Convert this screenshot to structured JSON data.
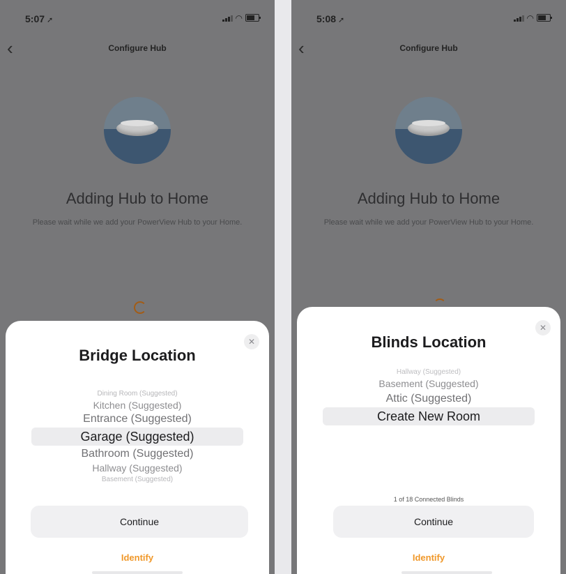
{
  "left_screen": {
    "status": {
      "time": "5:07",
      "location_icon": "location-arrow-icon"
    },
    "nav": {
      "back_icon": "chevron-left-icon",
      "title": "Configure Hub"
    },
    "background": {
      "heading": "Adding Hub to Home",
      "subtitle": "Please wait while we add your PowerView Hub to your Home.",
      "spinner_color": "#a35c15"
    },
    "sheet": {
      "title": "Bridge Location",
      "close_icon": "close-icon",
      "picker": [
        "Dining Room (Suggested)",
        "Kitchen (Suggested)",
        "Entrance (Suggested)",
        "Garage (Suggested)",
        "Bathroom (Suggested)",
        "Hallway (Suggested)",
        "Basement (Suggested)"
      ],
      "selected": "Garage (Suggested)",
      "continue_label": "Continue",
      "identify_label": "Identify"
    }
  },
  "right_screen": {
    "status": {
      "time": "5:08",
      "location_icon": "location-arrow-icon"
    },
    "nav": {
      "back_icon": "chevron-left-icon",
      "title": "Configure Hub"
    },
    "background": {
      "heading": "Adding Hub to Home",
      "subtitle": "Please wait while we add your PowerView Hub to your Home.",
      "spinner_color": "#a35c15"
    },
    "sheet": {
      "title": "Blinds Location",
      "close_icon": "close-icon",
      "picker": [
        "Hallway (Suggested)",
        "Basement (Suggested)",
        "Attic (Suggested)",
        "Create New Room"
      ],
      "selected": "Create New Room",
      "counter": "1 of 18 Connected Blinds",
      "continue_label": "Continue",
      "identify_label": "Identify"
    }
  },
  "colors": {
    "accent": "#f0982a",
    "dim_background": "#777779",
    "sheet": "#ffffff"
  }
}
